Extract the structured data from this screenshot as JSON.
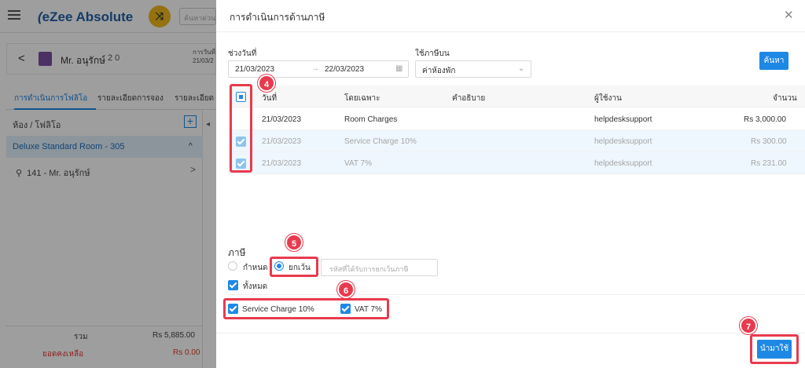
{
  "app": {
    "logo": "eZee Absolute",
    "search_placeholder": "ค้นหาด่วน"
  },
  "guest": {
    "name": "Mr. อนุรักษ์",
    "pax": "2  0",
    "info_line1": "การวันที่",
    "info_line2": "21/03/2"
  },
  "tabs": [
    {
      "label": "การดำเนินการโฟลิโอ"
    },
    {
      "label": "รายละเอียดการจอง"
    },
    {
      "label": "รายละเอียด"
    }
  ],
  "left_panel": {
    "header": "ห้อง / โฟลิโอ",
    "room": "Deluxe Standard Room - 305",
    "guest_folio": "141 - Mr. อนุรักษ์",
    "total_label": "รวม",
    "total_value": "Rs 5,885.00",
    "balance_label": "ยอดคงเหลือ",
    "balance_value": "Rs 0.00"
  },
  "modal": {
    "title": "การดำเนินการด้านภาษี",
    "date_range_label": "ช่วงวันที่",
    "date_from": "21/03/2023",
    "date_to": "22/03/2023",
    "apply_on_label": "ใช้ภาษีบน",
    "apply_on_value": "ค่าห้องพัก",
    "search_button": "ค้นหา",
    "columns": {
      "date": "วันที่",
      "specific": "โดยเฉพาะ",
      "description": "คำอธิบาย",
      "user": "ผู้ใช้งาน",
      "amount": "จำนวน"
    },
    "rows": [
      {
        "date": "21/03/2023",
        "specific": "Room Charges",
        "description": "",
        "user": "helpdesksupport",
        "amount": "Rs 3,000.00",
        "checked": false
      },
      {
        "date": "21/03/2023",
        "specific": "Service Charge 10%",
        "description": "",
        "user": "helpdesksupport",
        "amount": "Rs 300.00",
        "checked": true
      },
      {
        "date": "21/03/2023",
        "specific": "VAT 7%",
        "description": "",
        "user": "helpdesksupport",
        "amount": "Rs 231.00",
        "checked": true
      }
    ],
    "tax_label": "ภาษี",
    "radio_define": "กำหนด",
    "radio_exempt": "ยกเว้น",
    "exempt_placeholder": "รหัสที่ได้รับการยกเว้นภาษี",
    "all_label": "ทั้งหมด",
    "tax_options": [
      "Service Charge 10%",
      "VAT 7%"
    ],
    "apply_button": "นำมาใช้"
  },
  "annotations": [
    "4",
    "5",
    "6",
    "7"
  ],
  "colors": {
    "accent": "#1e88e5",
    "highlight": "#e83a4e",
    "brand_yellow": "#f0b81c"
  }
}
